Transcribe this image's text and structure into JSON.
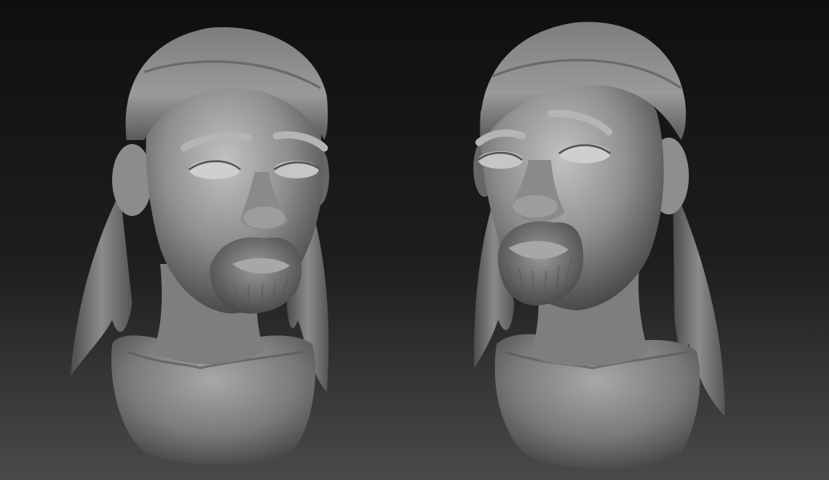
{
  "scene": {
    "subject": "sculpted-bust-render",
    "views": [
      "front-left-view",
      "front-right-view"
    ],
    "colors": {
      "background_top": "#101010",
      "background_bottom": "#4a4a4a",
      "clay_light": "#b9b9b9",
      "clay_mid": "#8a8a8a",
      "clay_dark": "#3c3c3c"
    }
  }
}
